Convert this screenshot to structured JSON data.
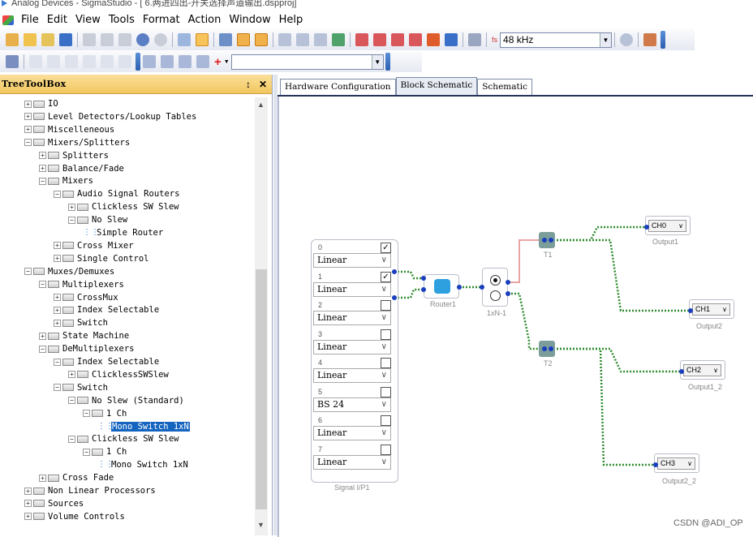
{
  "window": {
    "title": "Analog Devices - SigmaStudio - [ 6.两进四出-开关选择声道输出.dspproj]"
  },
  "menu": [
    "File",
    "Edit",
    "View",
    "Tools",
    "Format",
    "Action",
    "Window",
    "Help"
  ],
  "toolbar": {
    "sample_rate": "48 kHz",
    "fs_label": "fs"
  },
  "tree_panel": {
    "title": "TreeToolBox",
    "pin": "↕",
    "close": "✕",
    "items": [
      {
        "label": "IO",
        "depth": 0,
        "exp": "+"
      },
      {
        "label": "Level Detectors/Lookup Tables",
        "depth": 0,
        "exp": "+"
      },
      {
        "label": "Miscelleneous",
        "depth": 0,
        "exp": "+"
      },
      {
        "label": "Mixers/Splitters",
        "depth": 0,
        "exp": "-"
      },
      {
        "label": "Splitters",
        "depth": 1,
        "exp": "+"
      },
      {
        "label": "Balance/Fade",
        "depth": 1,
        "exp": "+"
      },
      {
        "label": "Mixers",
        "depth": 1,
        "exp": "-"
      },
      {
        "label": "Audio Signal Routers",
        "depth": 2,
        "exp": "-"
      },
      {
        "label": "Clickless SW Slew",
        "depth": 3,
        "exp": "+"
      },
      {
        "label": "No Slew",
        "depth": 3,
        "exp": "-"
      },
      {
        "label": "Simple Router",
        "depth": 4,
        "exp": "leaf"
      },
      {
        "label": "Cross Mixer",
        "depth": 2,
        "exp": "+"
      },
      {
        "label": "Single Control",
        "depth": 2,
        "exp": "+"
      },
      {
        "label": "Muxes/Demuxes",
        "depth": 0,
        "exp": "-"
      },
      {
        "label": "Multiplexers",
        "depth": 1,
        "exp": "-"
      },
      {
        "label": "CrossMux",
        "depth": 2,
        "exp": "+"
      },
      {
        "label": "Index Selectable",
        "depth": 2,
        "exp": "+"
      },
      {
        "label": "Switch",
        "depth": 2,
        "exp": "+"
      },
      {
        "label": "State Machine",
        "depth": 1,
        "exp": "+"
      },
      {
        "label": "DeMultiplexers",
        "depth": 1,
        "exp": "-"
      },
      {
        "label": "Index Selectable",
        "depth": 2,
        "exp": "-"
      },
      {
        "label": "ClicklessSWSlew",
        "depth": 3,
        "exp": "+"
      },
      {
        "label": "Switch",
        "depth": 2,
        "exp": "-"
      },
      {
        "label": "No Slew (Standard)",
        "depth": 3,
        "exp": "-"
      },
      {
        "label": "1 Ch",
        "depth": 4,
        "exp": "-"
      },
      {
        "label": "Mono Switch 1xN",
        "depth": 5,
        "exp": "leaf",
        "selected": true
      },
      {
        "label": "Clickless SW Slew",
        "depth": 3,
        "exp": "-"
      },
      {
        "label": "1 Ch",
        "depth": 4,
        "exp": "-"
      },
      {
        "label": "Mono Switch 1xN",
        "depth": 5,
        "exp": "leaf"
      },
      {
        "label": "Cross Fade",
        "depth": 1,
        "exp": "+"
      },
      {
        "label": "Non Linear Processors",
        "depth": 0,
        "exp": "+"
      },
      {
        "label": "Sources",
        "depth": 0,
        "exp": "+"
      },
      {
        "label": "Volume Controls",
        "depth": 0,
        "exp": "+"
      }
    ]
  },
  "tabs": [
    "Hardware Configuration",
    "Block Schematic",
    "Schematic"
  ],
  "active_tab": 1,
  "signal_block": {
    "label": "Signal I/P1",
    "rows": [
      {
        "num": "0",
        "mode": "Linear",
        "checked": true
      },
      {
        "num": "1",
        "mode": "Linear",
        "checked": true
      },
      {
        "num": "2",
        "mode": "Linear",
        "checked": false
      },
      {
        "num": "3",
        "mode": "Linear",
        "checked": false
      },
      {
        "num": "4",
        "mode": "Linear",
        "checked": false
      },
      {
        "num": "5",
        "mode": "BS 24",
        "checked": false
      },
      {
        "num": "6",
        "mode": "Linear",
        "checked": false
      },
      {
        "num": "7",
        "mode": "Linear",
        "checked": false
      }
    ]
  },
  "blocks": {
    "router": "Router1",
    "switch": "1xN-1",
    "t1": "T1",
    "t2": "T2"
  },
  "outputs": [
    {
      "channel": "CH0",
      "label": "Output1"
    },
    {
      "channel": "CH1",
      "label": "Output2"
    },
    {
      "channel": "CH2",
      "label": "Output1_2"
    },
    {
      "channel": "CH3",
      "label": "Output2_2"
    }
  ],
  "colors": {
    "wire": "#2e8b2e",
    "selection": "#1565c0",
    "panel_header": "#f2c65e"
  },
  "watermark": "CSDN @ADI_OP"
}
